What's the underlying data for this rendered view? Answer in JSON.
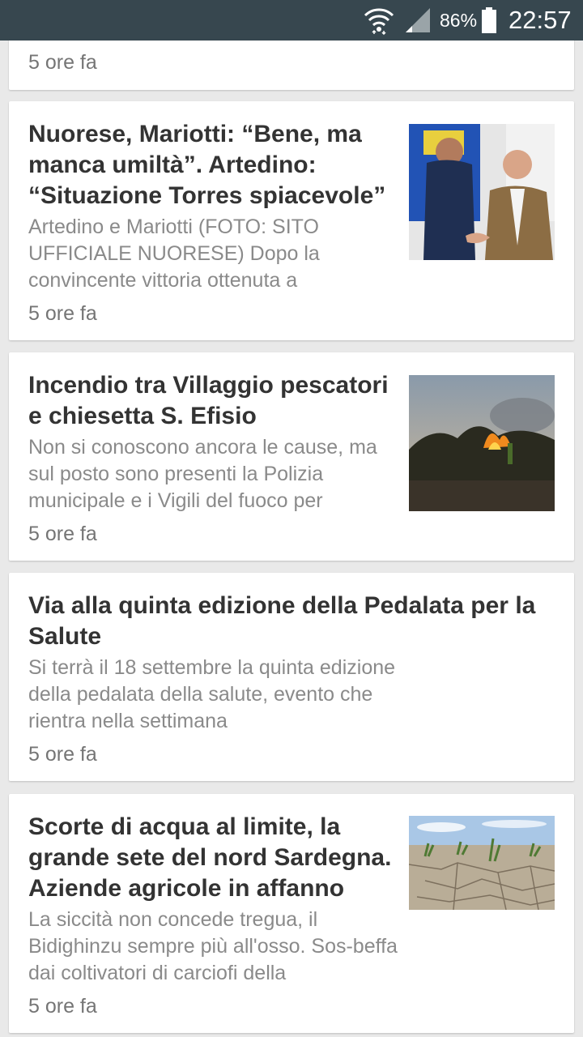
{
  "status_bar": {
    "battery_percent": "86%",
    "time": "22:57"
  },
  "articles": [
    {
      "title": "",
      "snippet": "",
      "time": "5 ore fa"
    },
    {
      "title": "Nuorese, Mariotti: “Bene, ma manca umiltà”. Artedino: “Situazione Torres spiacevole”",
      "snippet": "Artedino e Mariotti (FOTO: SITO UFFICIALE NUORESE) Dopo la convincente vittoria ottenuta a",
      "time": "5 ore fa",
      "thumbnail": "photo-two-men-handshake"
    },
    {
      "title": "Incendio tra Villaggio pescatori e chiesetta S. Efisio",
      "snippet": "Non si conoscono ancora le cause, ma sul posto sono presenti la Polizia municipale e i Vigili del fuoco per",
      "time": "5 ore fa",
      "thumbnail": "photo-bush-fire"
    },
    {
      "title": "Via alla quinta edizione della Pedalata per la Salute",
      "snippet": "Si terrà il 18 settembre la quinta edizione della pedalata della salute, evento che rientra nella settimana",
      "time": "5 ore fa"
    },
    {
      "title": "Scorte di acqua al limite, la grande sete del nord Sardegna. Aziende agricole in affanno",
      "snippet": "La siccità non concede tregua, il Bidighinzu sempre più all'osso. Sos-beffa dai coltivatori di carciofi della",
      "time": "5 ore fa",
      "thumbnail": "photo-dry-cracked-field"
    }
  ]
}
